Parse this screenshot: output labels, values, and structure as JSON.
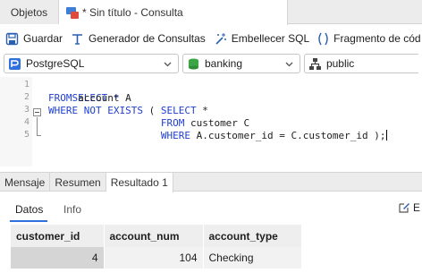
{
  "tabs": {
    "objects_label": "Objetos",
    "query_label": "* Sin título - Consulta"
  },
  "toolbar": {
    "save_label": "Guardar",
    "query_builder_label": "Generador de Consultas",
    "beautify_label": "Embellecer SQL",
    "snippet_label": "Fragmento de cód"
  },
  "selectors": {
    "connection": "PostgreSQL",
    "database": "banking",
    "schema": "public"
  },
  "editor": {
    "line_numbers": [
      "1",
      "2",
      "3",
      "4",
      "5"
    ],
    "lines": [
      [
        {
          "t": "SELECT *",
          "k": true
        }
      ],
      [
        {
          "t": "FROM",
          "k": true
        },
        {
          "t": " account A",
          "k": false
        }
      ],
      [
        {
          "t": "WHERE NOT EXISTS",
          "k": true
        },
        {
          "t": " ( ",
          "k": false
        },
        {
          "t": "SELECT",
          "k": true
        },
        {
          "t": " *",
          "k": false
        }
      ],
      [
        {
          "t": "                   FROM",
          "k": false
        },
        {
          "t": " customer C",
          "k": false
        }
      ],
      [
        {
          "t": "                   WHERE",
          "k": false
        },
        {
          "t": " A.customer_id = C.customer_id );",
          "k": false
        }
      ]
    ]
  },
  "result_tabs": [
    "Mensaje",
    "Resumen",
    "Resultado 1"
  ],
  "sub_tabs": {
    "data_label": "Datos",
    "info_label": "Info",
    "edit_label": "E"
  },
  "grid": {
    "columns": [
      "customer_id",
      "account_num",
      "account_type"
    ],
    "rows": [
      [
        "4",
        "104",
        "Checking"
      ]
    ]
  },
  "colors": {
    "keyword": "#1f3fd1",
    "accent": "#2f6fe0"
  }
}
